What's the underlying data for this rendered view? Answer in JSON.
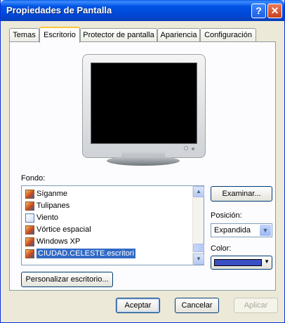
{
  "window": {
    "title": "Propiedades de Pantalla",
    "help_label": "?",
    "close_label": "✕"
  },
  "tabs": [
    {
      "label": "Temas"
    },
    {
      "label": "Escritorio"
    },
    {
      "label": "Protector de pantalla"
    },
    {
      "label": "Apariencia"
    },
    {
      "label": "Configuración"
    }
  ],
  "desktop": {
    "background_label": "Fondo:",
    "backgrounds": [
      {
        "label": "Síganme",
        "icon": "image-file-icon"
      },
      {
        "label": "Tulipanes",
        "icon": "image-file-icon"
      },
      {
        "label": "Viento",
        "icon": "image-file-icon"
      },
      {
        "label": "Vórtice espacial",
        "icon": "image-file-icon"
      },
      {
        "label": "Windows XP",
        "icon": "image-file-icon"
      },
      {
        "label": "CIUDAD.CELESTE.escritori",
        "icon": "image-file-icon",
        "selected": true
      }
    ],
    "browse_label": "Examinar...",
    "position_label": "Posición:",
    "position_value": "Expandida",
    "color_label": "Color:",
    "color_value": "#3a4fc4",
    "customize_label": "Personalizar escritorio..."
  },
  "footer": {
    "accept_label": "Aceptar",
    "cancel_label": "Cancelar",
    "apply_label": "Aplicar"
  }
}
